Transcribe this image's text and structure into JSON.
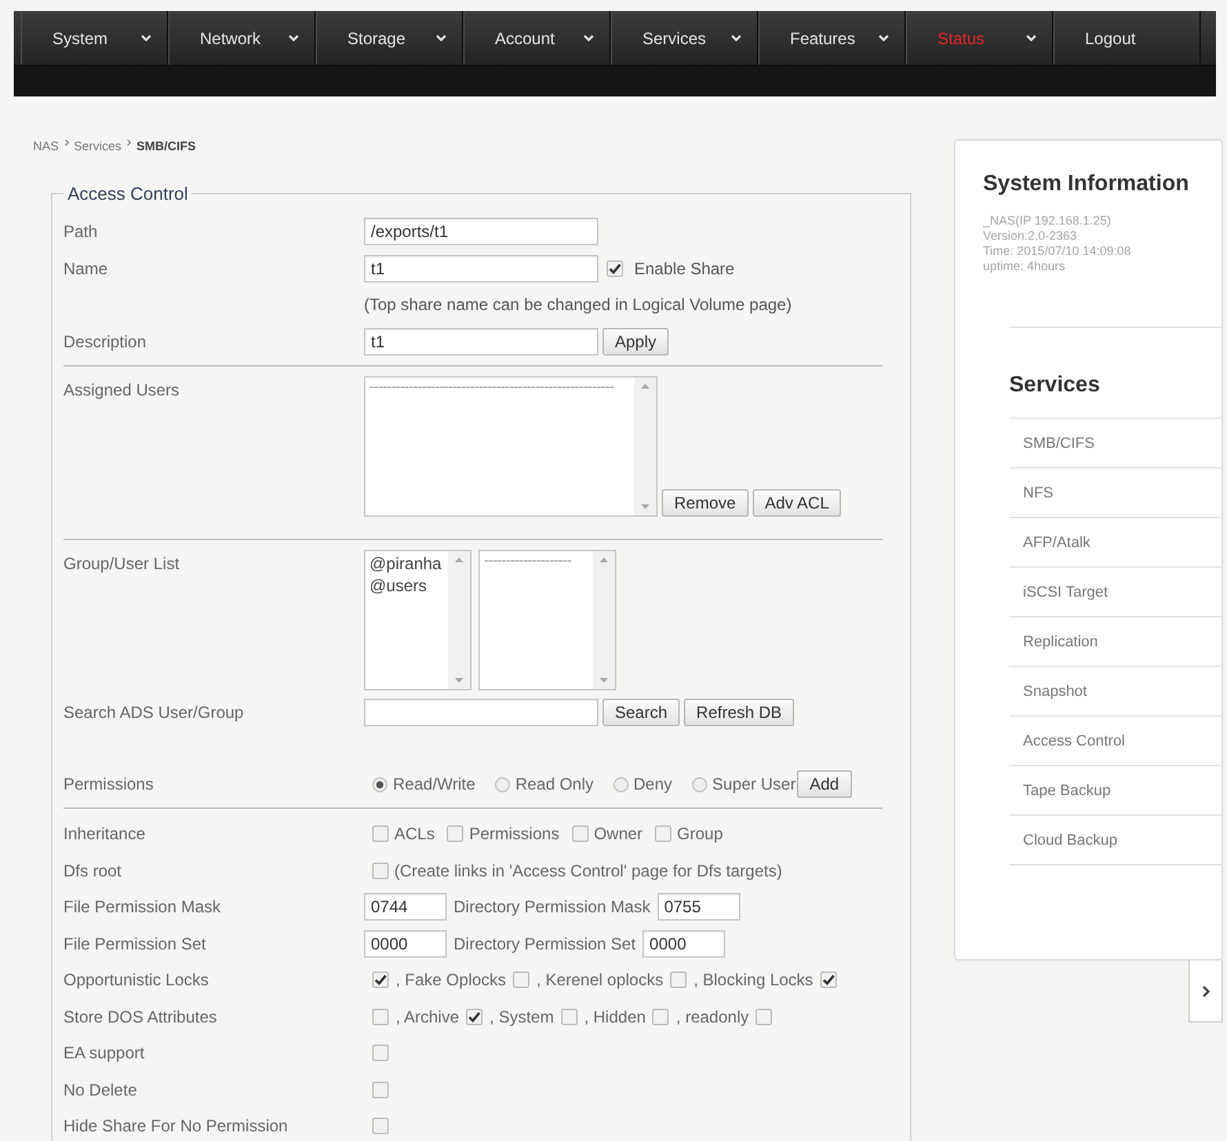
{
  "nav": [
    {
      "label": "System",
      "dropdown": true,
      "selected": false
    },
    {
      "label": "Network",
      "dropdown": true,
      "selected": false
    },
    {
      "label": "Storage",
      "dropdown": true,
      "selected": false
    },
    {
      "label": "Account",
      "dropdown": true,
      "selected": false
    },
    {
      "label": "Services",
      "dropdown": true,
      "selected": false
    },
    {
      "label": "Features",
      "dropdown": true,
      "selected": false
    },
    {
      "label": "Status",
      "dropdown": true,
      "selected": true
    },
    {
      "label": "Logout",
      "dropdown": false,
      "selected": false
    }
  ],
  "breadcrumb": [
    "NAS",
    "Services",
    "SMB/CIFS"
  ],
  "access_control": {
    "legend": "Access Control",
    "rows": [
      {
        "kind": "text",
        "label": "Path",
        "value": "/exports/t1"
      },
      {
        "kind": "text",
        "label": "Name",
        "value": "t1",
        "checkbox": {
          "label": "Enable Share",
          "checked": true
        }
      },
      {
        "kind": "note",
        "text": "(Top share name can be changed in Logical Volume page)"
      },
      {
        "kind": "text",
        "label": "Description",
        "value": "t1",
        "buttons": [
          "Apply"
        ]
      },
      {
        "kind": "divider"
      },
      {
        "kind": "lists",
        "label": "Assigned Users",
        "lists": [
          {
            "options": [
              "--------------------------------------------------------"
            ]
          }
        ],
        "buttons": [
          "Remove",
          "Adv ACL"
        ]
      },
      {
        "kind": "divider"
      },
      {
        "kind": "lists",
        "label": "Group/User List",
        "lists": [
          {
            "options": [
              "@piranha",
              "@users"
            ]
          },
          {
            "options": [
              "--------------------"
            ]
          }
        ]
      },
      {
        "kind": "text",
        "label": "Search ADS User/Group",
        "buttons": [
          "Search",
          "Refresh DB"
        ]
      },
      {
        "kind": "radios",
        "label": "Permissions",
        "options": [
          {
            "label": "Read/Write",
            "selected": true
          },
          {
            "label": "Read Only",
            "selected": false
          },
          {
            "label": "Deny",
            "selected": false
          },
          {
            "label": "Super User",
            "selected": false
          }
        ],
        "buttons": [
          "Add"
        ]
      },
      {
        "kind": "divider"
      },
      {
        "kind": "checks",
        "label": "Inheritance",
        "options": [
          {
            "label": "ACLs",
            "checked": false
          },
          {
            "label": "Permissions",
            "checked": false
          },
          {
            "label": "Owner",
            "checked": false
          },
          {
            "label": "Group",
            "checked": false
          }
        ]
      },
      {
        "kind": "checks",
        "label": "Dfs root",
        "options": [
          {
            "label": "(Create links in 'Access Control' page for Dfs targets)",
            "checked": false
          }
        ]
      },
      {
        "kind": "masks",
        "label": "File Permission Mask",
        "fields": [
          {
            "value": "0744"
          },
          {
            "label": "Directory Permission Mask",
            "value": "0755"
          }
        ]
      },
      {
        "kind": "masks",
        "label": "File Permission Set",
        "fields": [
          {
            "value": "0000"
          },
          {
            "label": "Directory Permission Set",
            "value": "0000"
          }
        ]
      },
      {
        "kind": "flags",
        "label": "Opportunistic Locks",
        "options": [
          {
            "checked": true
          },
          {
            "label": ", Fake Oplocks",
            "checked": false
          },
          {
            "label": ", Kerenel oplocks",
            "checked": false
          },
          {
            "label": ", Blocking Locks",
            "checked": true
          }
        ]
      },
      {
        "kind": "flags",
        "label": "Store DOS Attributes",
        "options": [
          {
            "checked": false
          },
          {
            "label": ", Archive",
            "checked": true
          },
          {
            "label": ", System",
            "checked": false
          },
          {
            "label": ", Hidden",
            "checked": false
          },
          {
            "label": ", readonly",
            "checked": false
          }
        ]
      },
      {
        "kind": "checks",
        "label": "EA support",
        "options": [
          {
            "checked": false
          }
        ]
      },
      {
        "kind": "checks",
        "label": "No Delete",
        "options": [
          {
            "checked": false
          }
        ]
      },
      {
        "kind": "checks",
        "label": "Hide Share For No Permission",
        "options": [
          {
            "checked": false
          }
        ]
      }
    ]
  },
  "system_information": {
    "title": "System Information",
    "lines": [
      "_NAS(IP 192.168.1.25)",
      "Version:2.0-2363",
      "Time: 2015/07/10 14:09:08",
      "uptime: 4hours"
    ]
  },
  "services": {
    "title": "Services",
    "items": [
      "SMB/CIFS",
      "NFS",
      "AFP/Atalk",
      "iSCSI Target",
      "Replication",
      "Snapshot",
      "Access Control",
      "Tape Backup",
      "Cloud Backup"
    ]
  }
}
